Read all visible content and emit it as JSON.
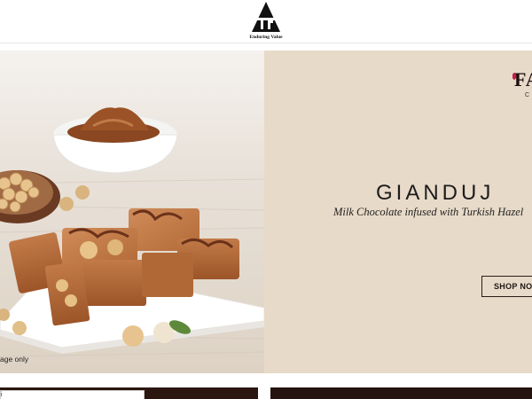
{
  "header": {
    "logo_tagline": "Enduring Value"
  },
  "hero": {
    "brand_text": "FA",
    "brand_sub": "C",
    "title": "GIANDUJ",
    "subtitle": "Milk Chocolate infused with Turkish Hazel",
    "cta_label": "SHOP NO",
    "image_disclaimer": "age only"
  },
  "bottom": {
    "search_value": "i"
  },
  "colors": {
    "hero_bg": "#e8dac8",
    "chocolate": "#b5693b",
    "dark_panel": "#2b1610"
  }
}
